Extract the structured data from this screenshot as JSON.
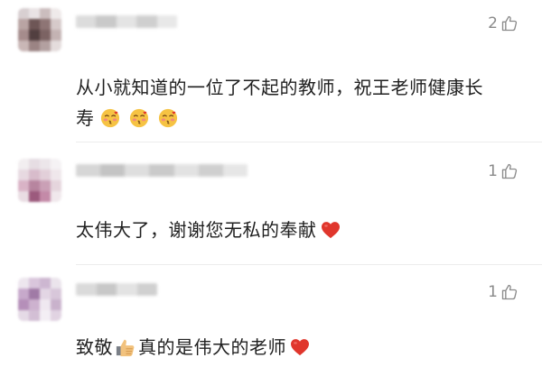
{
  "comments": [
    {
      "like_count": "2",
      "text_line1": "从小就知道的一位了不起的教师，祝王老师健康长",
      "text_line2": "寿",
      "emoji_icon": "blushing-kiss-face-emoji",
      "emoji_count": 3
    },
    {
      "like_count": "1",
      "text": "太伟大了，谢谢您无私的奉献",
      "trailing_icon": "red-heart-emoji"
    },
    {
      "like_count": "1",
      "text_before": "致敬",
      "inline_icon": "thumbs-up-emoji",
      "text_after": "真的是伟大的老师",
      "trailing_icon": "red-heart-emoji"
    }
  ],
  "colors": {
    "text": "#1f1f1f",
    "like_gray": "#8a8a8a",
    "divider": "#ececec",
    "heart_red": "#e0362c",
    "emoji_yellow": "#f6c343"
  }
}
